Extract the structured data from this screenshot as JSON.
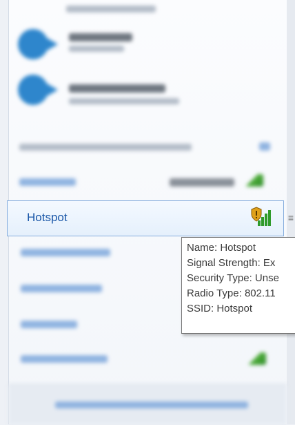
{
  "network_list": {
    "selected": {
      "name": "Hotspot",
      "icon": "wifi-secured-signal-icon"
    },
    "tooltip": {
      "lines": [
        "Name: Hotspot",
        "Signal Strength: Ex",
        "Security Type: Unse",
        "Radio Type: 802.11",
        "SSID: Hotspot"
      ]
    }
  },
  "colors": {
    "accent": "#1a57a8",
    "selection_border": "#84acdd",
    "signal_green": "#2e8b2a",
    "shield_gold": "#e0a11a"
  }
}
